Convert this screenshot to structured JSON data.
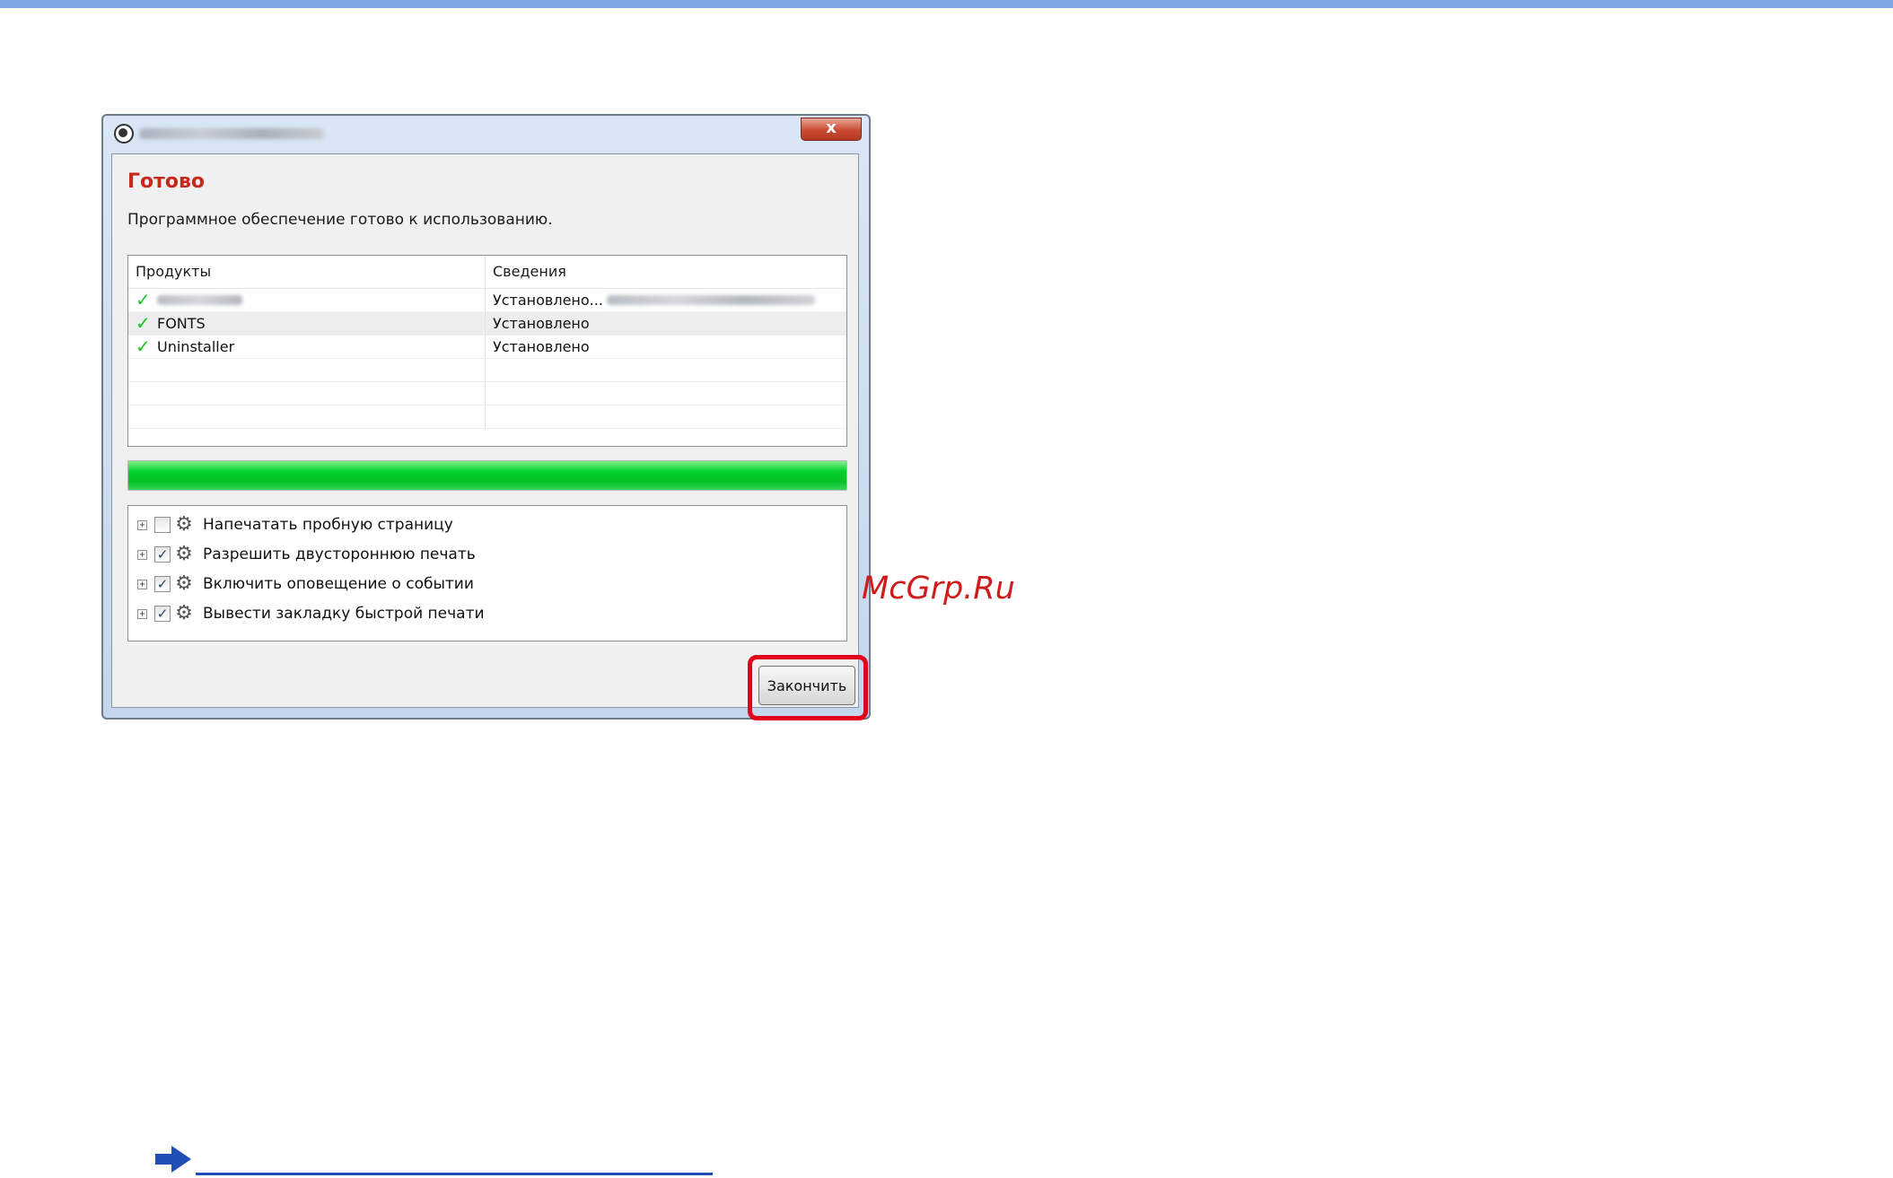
{
  "dialog": {
    "heading": "Готово",
    "subtext": "Программное обеспечение готово к использованию.",
    "close_label": "x",
    "table": {
      "headers": [
        "Продукты",
        "Сведения"
      ],
      "rows": [
        {
          "product": "",
          "detail": "Установлено...",
          "status_icon": "check-icon"
        },
        {
          "product": "FONTS",
          "detail": "Установлено",
          "status_icon": "check-icon"
        },
        {
          "product": "Uninstaller",
          "detail": "Установлено",
          "status_icon": "check-icon"
        }
      ]
    },
    "progress": {
      "value": 1.0,
      "color": "#06d12e"
    },
    "options": [
      {
        "label": "Напечатать пробную страницу",
        "checked": false
      },
      {
        "label": "Разрешить двустороннюю печать",
        "checked": true
      },
      {
        "label": "Включить оповещение о событии",
        "checked": true
      },
      {
        "label": "Вывести закладку быстрой печати",
        "checked": true
      }
    ],
    "finish_label": "Закончить"
  },
  "watermark": "McGrp.Ru",
  "colors": {
    "heading": "#c8271b",
    "highlight": "#e3001b",
    "top_bar": "#7fa6e6"
  }
}
